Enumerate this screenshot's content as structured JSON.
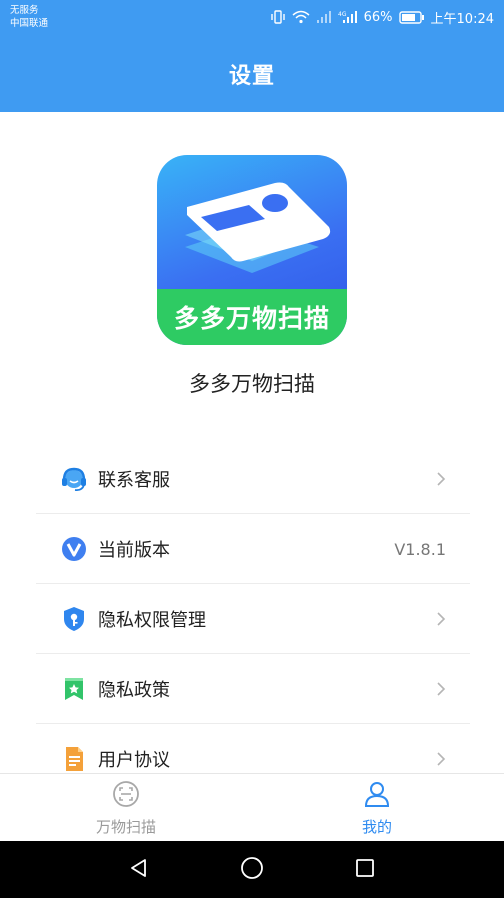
{
  "status_bar": {
    "line1": "无服务",
    "line2": "中国联通",
    "battery_text": "66%",
    "time": "上午10:24",
    "icons": [
      "vibrate-icon",
      "wifi-icon",
      "signal-icon",
      "signal-4g-icon",
      "battery-icon"
    ]
  },
  "header": {
    "title": "设置"
  },
  "app": {
    "logo_text": "多多万物扫描",
    "name": "多多万物扫描"
  },
  "menu": {
    "items": [
      {
        "label": "联系客服",
        "icon": "headset-icon",
        "right": "chevron"
      },
      {
        "label": "当前版本",
        "icon": "version-v-icon",
        "value": "V1.8.1"
      },
      {
        "label": "隐私权限管理",
        "icon": "shield-key-icon",
        "right": "chevron"
      },
      {
        "label": "隐私政策",
        "icon": "bookmark-star-icon",
        "right": "chevron"
      },
      {
        "label": "用户协议",
        "icon": "document-icon",
        "right": "chevron"
      }
    ]
  },
  "tabbar": {
    "tabs": [
      {
        "label": "万物扫描",
        "icon": "scan-frame-icon",
        "active": false
      },
      {
        "label": "我的",
        "icon": "person-icon",
        "active": true
      }
    ]
  },
  "colors": {
    "primary": "#3f9bf2",
    "active_tab": "#2f8bf0",
    "logo_green": "#2ecb63"
  }
}
